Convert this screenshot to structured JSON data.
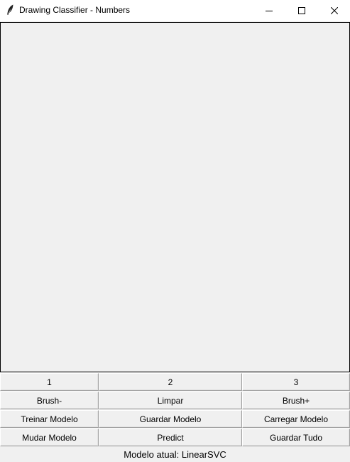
{
  "window": {
    "title": "Drawing Classifier - Numbers",
    "icon": "feather-icon",
    "controls": [
      "minimize-icon",
      "maximize-icon",
      "close-icon"
    ]
  },
  "canvas": {
    "background": "#f0f0f0"
  },
  "buttons": {
    "row1": [
      "1",
      "2",
      "3"
    ],
    "row2": [
      "Brush-",
      "Limpar",
      "Brush+"
    ],
    "row3": [
      "Treinar Modelo",
      "Guardar Modelo",
      "Carregar Modelo"
    ],
    "row4": [
      "Mudar Modelo",
      "Predict",
      "Guardar Tudo"
    ]
  },
  "status": {
    "text": "Modelo atual: LinearSVC"
  }
}
